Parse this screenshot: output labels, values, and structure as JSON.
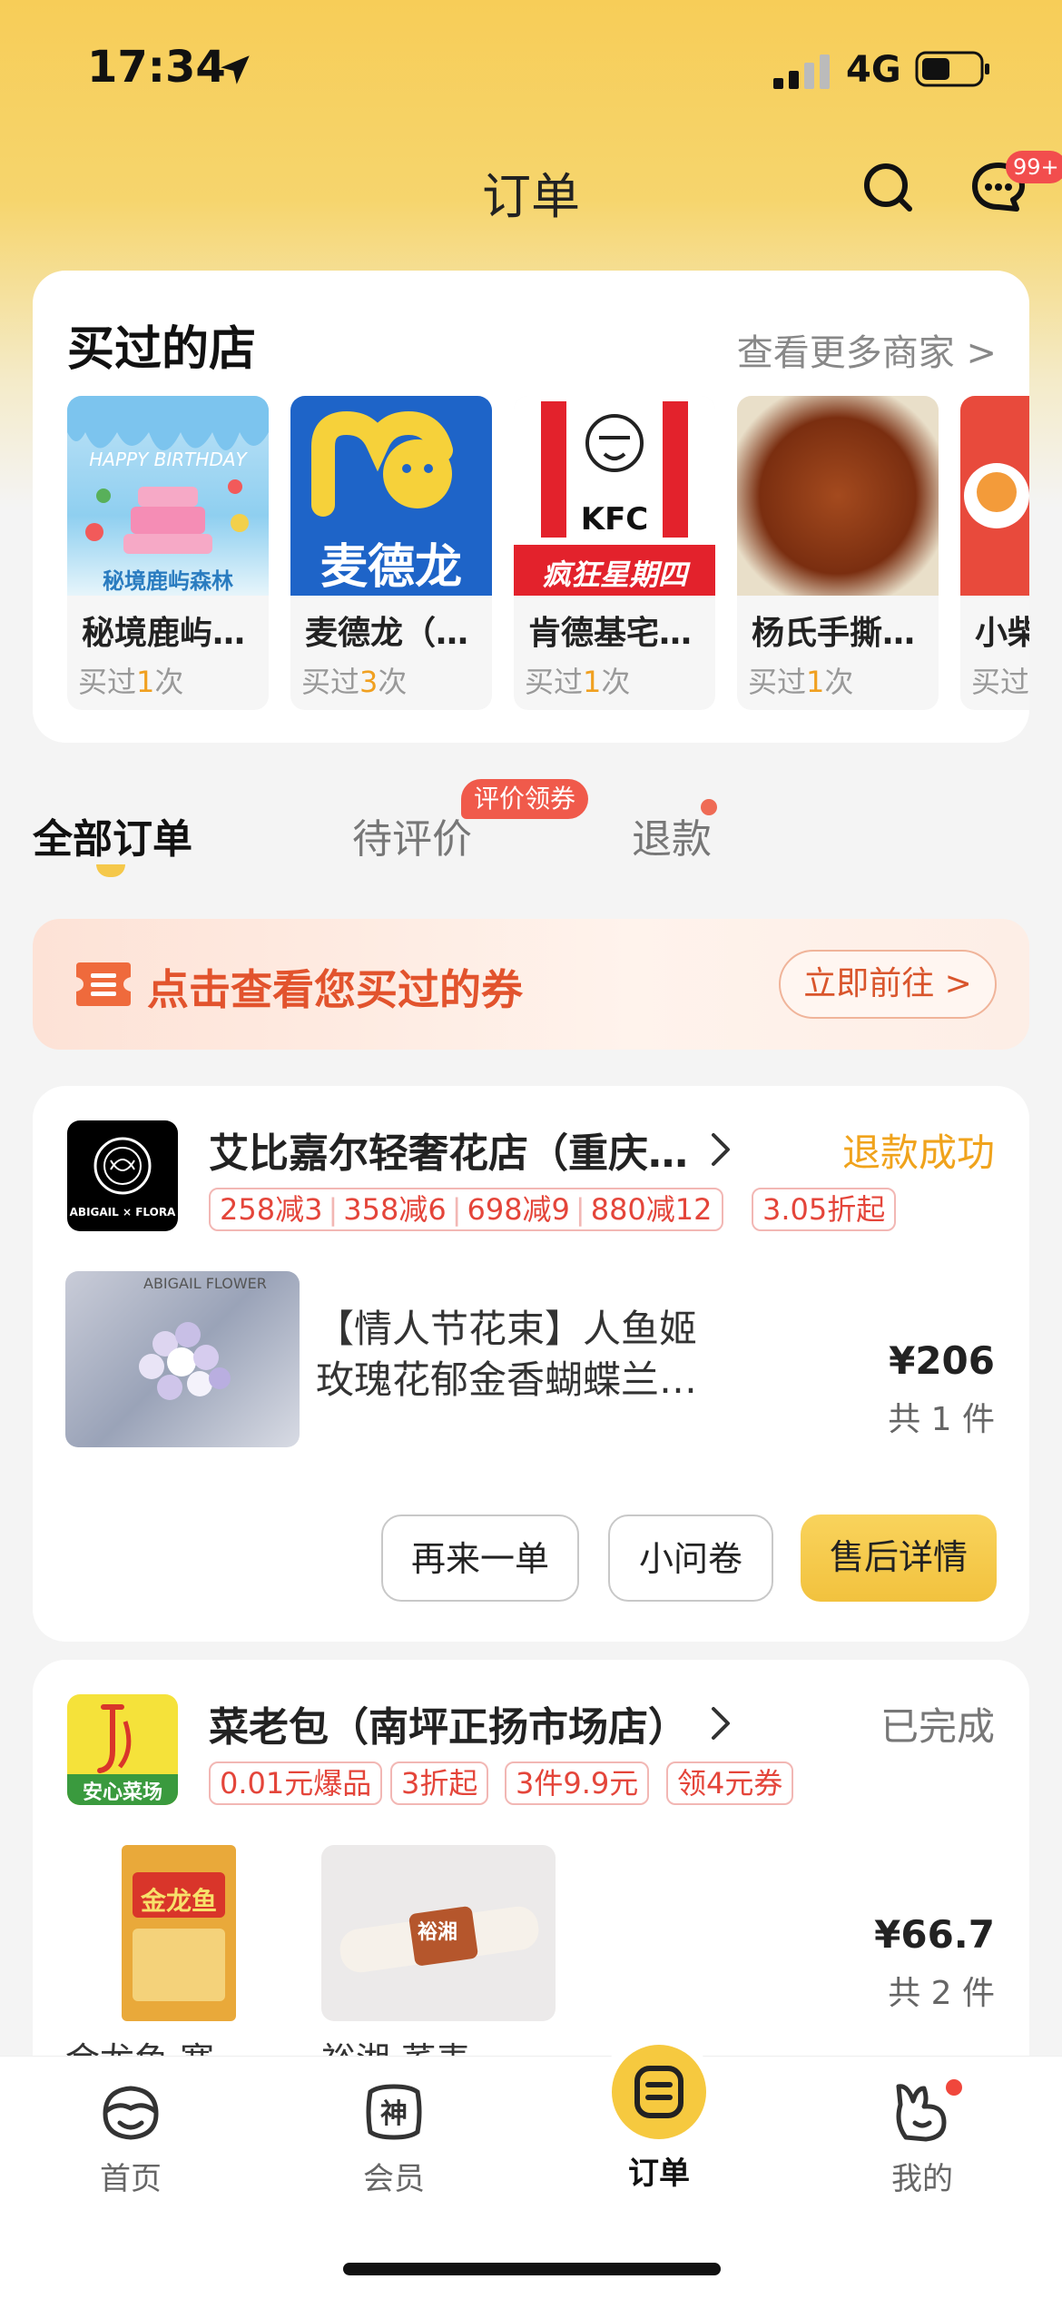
{
  "status_bar": {
    "time": "17:34",
    "network": "4G"
  },
  "header": {
    "title": "订单",
    "message_badge": "99+"
  },
  "stores": {
    "title": "买过的店",
    "more_label": "查看更多商家 >",
    "items": [
      {
        "name": "秘境鹿屿…",
        "bought_prefix": "买过",
        "count": "1",
        "bought_suffix": "次",
        "image_text": "HAPPY BIRTHDAY",
        "image_caption": "秘境鹿屿森林"
      },
      {
        "name": "麦德龙（…",
        "bought_prefix": "买过",
        "count": "3",
        "bought_suffix": "次",
        "image_text": "麦德龙"
      },
      {
        "name": "肯德基宅…",
        "bought_prefix": "买过",
        "count": "1",
        "bought_suffix": "次",
        "image_text": "KFC",
        "image_caption": "疯狂星期四"
      },
      {
        "name": "杨氏手撕…",
        "bought_prefix": "买过",
        "count": "1",
        "bought_suffix": "次"
      },
      {
        "name": "小柴",
        "bought_prefix": "买过",
        "count": "",
        "bought_suffix": ""
      }
    ]
  },
  "tabs": [
    {
      "label": "全部订单"
    },
    {
      "label": "待评价",
      "badge": "评价领券"
    },
    {
      "label": "退款"
    }
  ],
  "coupon_banner": {
    "text": "点击查看您买过的券",
    "button": "立即前往 >"
  },
  "orders": [
    {
      "shop": "艾比嘉尔轻奢花店（重庆…",
      "logo_text": "ABIGAIL × FLORA",
      "status": "退款成功",
      "status_color": "#f0a31c",
      "promos": [
        "258减3",
        "358减6",
        "698减9",
        "880减12",
        "3.05折起"
      ],
      "product_title": "【情人节花束】人鱼姬玫瑰花郁金香蝴蝶兰…",
      "product_image_text": "ABIGAIL FLOWER",
      "price": "¥206",
      "quantity": "共 1 件",
      "buttons": [
        "再来一单",
        "小问卷",
        "售后详情"
      ]
    },
    {
      "shop": "菜老包（南坪正扬市场店）",
      "logo_text": "安心菜场",
      "status": "已完成",
      "status_color": "#777777",
      "promos": [
        "0.01元爆品",
        "3折起",
        "3件9.9元",
        "领4元券"
      ],
      "captions": [
        "金龙鱼 寒…",
        "裕湘 荞麦…"
      ],
      "product_image_texts": [
        "金龙鱼",
        "裕湘"
      ],
      "price": "¥66.7",
      "quantity": "共 2 件"
    }
  ],
  "bottom_nav": [
    {
      "label": "首页",
      "icon": "home-face-icon"
    },
    {
      "label": "会员",
      "icon": "member-shen-icon"
    },
    {
      "label": "订单",
      "icon": "order-list-icon"
    },
    {
      "label": "我的",
      "icon": "profile-rabbit-icon"
    }
  ],
  "colors": {
    "brand_yellow": "#f6c93f",
    "accent_red": "#e4453a",
    "count_orange": "#f0a020"
  }
}
